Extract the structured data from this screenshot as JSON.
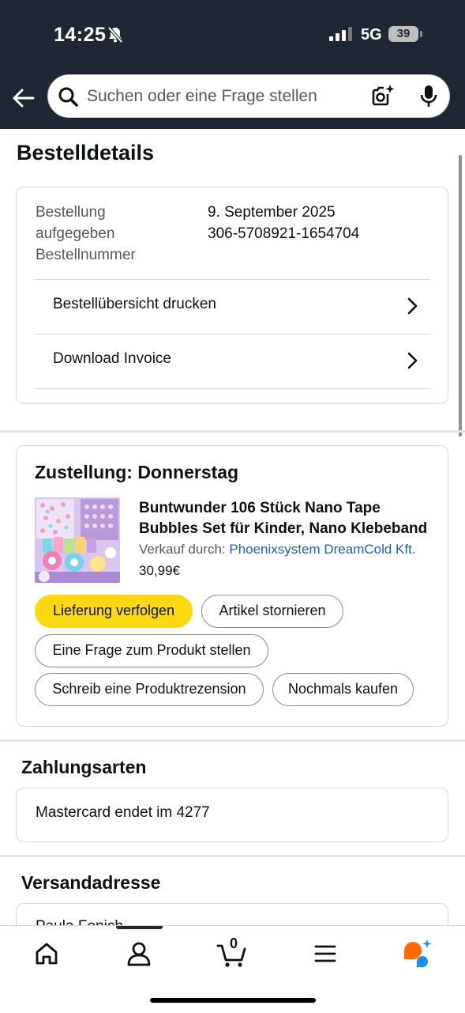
{
  "status_bar": {
    "time": "14:25",
    "network": "5G",
    "battery": "39"
  },
  "search": {
    "placeholder": "Suchen oder eine Frage stellen"
  },
  "page": {
    "title": "Bestelldetails"
  },
  "order_info": {
    "placed_label_line1": "Bestellung",
    "placed_label_line2": "aufgegeben",
    "number_label": "Bestellnummer",
    "date": "9. September 2025",
    "number": "306-5708921-1654704",
    "print_summary_label": "Bestellübersicht drucken",
    "download_invoice_label": "Download Invoice"
  },
  "delivery": {
    "title": "Zustellung: Donnerstag",
    "product_title_line1": "Buntwunder 106 Stück Nano Tape",
    "product_title_line2": "Bubbles Set für Kinder, Nano Klebeband",
    "seller_prefix": "Verkauf durch:",
    "seller_name": "Phoenixsystem DreamCold Kft.",
    "price": "30,99€",
    "buttons": {
      "track": "Lieferung verfolgen",
      "cancel": "Artikel stornieren",
      "ask": "Eine Frage zum Produkt stellen",
      "review": "Schreib eine Produktrezension",
      "buy_again": "Nochmals kaufen"
    }
  },
  "payment": {
    "title": "Zahlungsarten",
    "card_brand": "Mastercard",
    "card_ending": "endet im 4277"
  },
  "shipping": {
    "title": "Versandadresse",
    "name_partial": "Paula Fenich"
  },
  "bottom_nav": {
    "cart_count": "0"
  },
  "colors": {
    "header_bg": "#1e2733",
    "primary_button": "#ffd814",
    "link": "#2162a1",
    "rufus_orange": "#ff6a00",
    "rufus_blue": "#1f8ef1"
  }
}
